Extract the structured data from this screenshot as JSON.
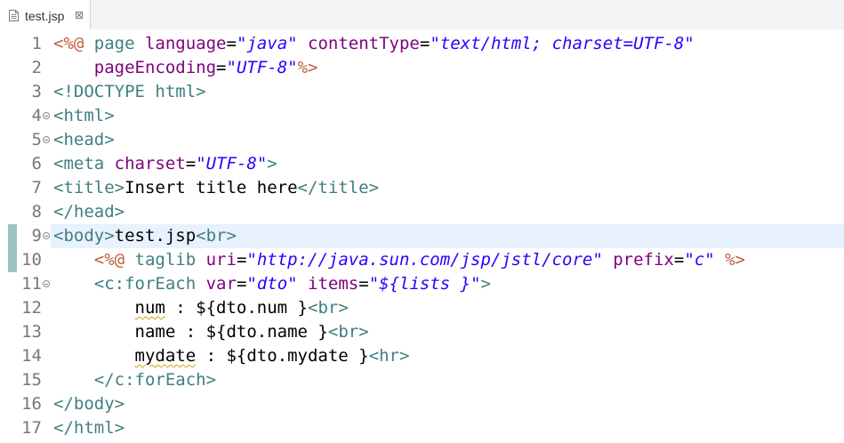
{
  "tab": {
    "title": "test.jsp",
    "close": "⊠"
  },
  "gutter": {
    "numbers": [
      "1",
      "2",
      "3",
      "4",
      "5",
      "6",
      "7",
      "8",
      "9",
      "10",
      "11",
      "12",
      "13",
      "14",
      "15",
      "16",
      "17"
    ]
  },
  "code": {
    "l1": [
      "<%@",
      " page ",
      "language",
      "=",
      "\"java\"",
      " ",
      "contentType",
      "=",
      "\"text/html; charset=UTF-8\""
    ],
    "l2": [
      "    ",
      "pageEncoding",
      "=",
      "\"UTF-8\"",
      "%>"
    ],
    "l3": [
      "<!DOCTYPE html>"
    ],
    "l4": [
      "<html>"
    ],
    "l5": [
      "<head>"
    ],
    "l6": [
      "<meta",
      " ",
      "charset",
      "=",
      "\"UTF-8\"",
      ">"
    ],
    "l7": [
      "<title>",
      "Insert title here",
      "</title>"
    ],
    "l8": [
      "</head>"
    ],
    "l9": [
      "<body>",
      "test.jsp",
      "<br>"
    ],
    "l10": [
      "    ",
      "<%@",
      " taglib ",
      "uri",
      "=",
      "\"http://java.sun.com/jsp/jstl/core\"",
      " ",
      "prefix",
      "=",
      "\"c\"",
      " ",
      "%>"
    ],
    "l11": [
      "    ",
      "<c:forEach",
      " ",
      "var",
      "=",
      "\"dto\"",
      " ",
      "items",
      "=",
      "\"${lists }\"",
      ">"
    ],
    "l12": [
      "        ",
      "num",
      " : ${dto.num }",
      "<br>"
    ],
    "l13": [
      "        ",
      "name",
      " : ${dto.name }",
      "<br>"
    ],
    "l14": [
      "        ",
      "mydate",
      " : ${dto.mydate }",
      "<hr>"
    ],
    "l15": [
      "    ",
      "</c:forEach>"
    ],
    "l16": [
      "</body>"
    ],
    "l17": [
      "</html>"
    ]
  }
}
